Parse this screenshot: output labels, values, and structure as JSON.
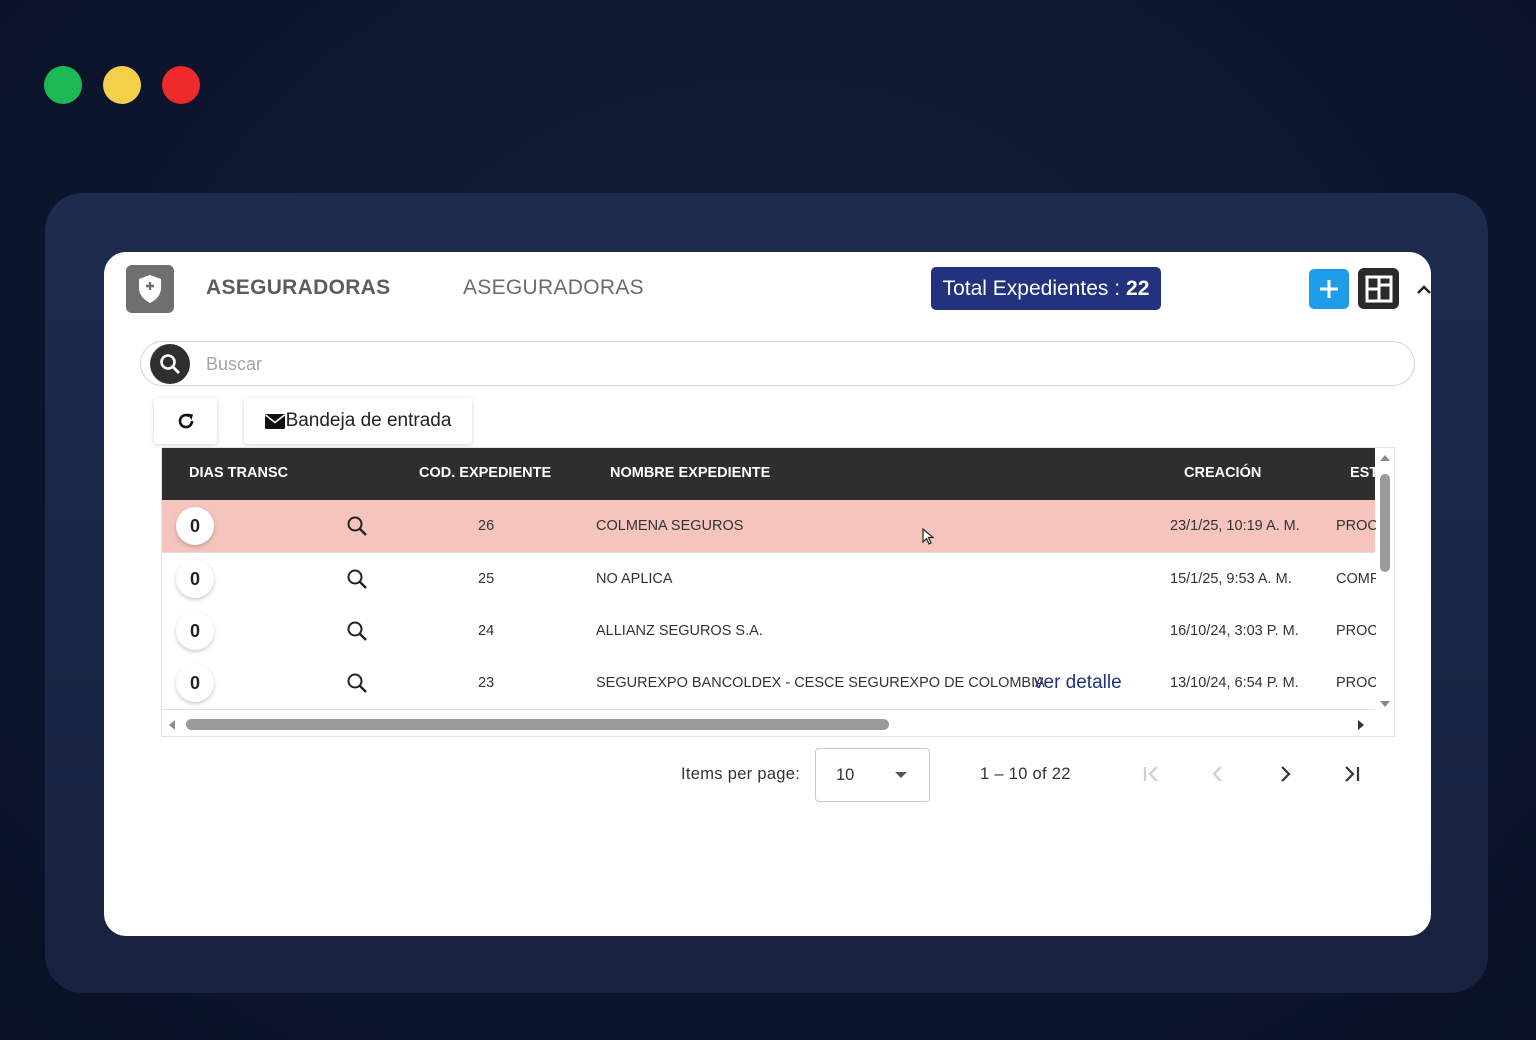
{
  "window_controls": {
    "close_color": "#ee2a2a",
    "minimize_color": "#f4cf4a",
    "maximize_color": "#1db954"
  },
  "header": {
    "logo_icon": "shield-plus-icon",
    "title": "ASEGURADORAS",
    "subtitle": "ASEGURADORAS",
    "total_label": "Total Expedientes :",
    "total_value": "22",
    "add_icon": "plus-icon",
    "layout_icon": "dashboard-layout-icon",
    "collapse_icon": "chevron-up-icon"
  },
  "search": {
    "placeholder": "Buscar",
    "value": ""
  },
  "toolbar": {
    "refresh_icon": "refresh-icon",
    "inbox_icon": "envelope-icon",
    "inbox_label": "Bandeja de entrada"
  },
  "table": {
    "columns": [
      "DIAS TRANSC",
      "COD. EXPEDIENTE",
      "NOMBRE EXPEDIENTE",
      "CREACIÓN",
      "EST"
    ],
    "rows": [
      {
        "dias": "0",
        "codigo": "26",
        "nombre": "COLMENA SEGUROS",
        "creacion": "23/1/25, 10:19 A. M.",
        "estado": "PROC",
        "highlighted": true
      },
      {
        "dias": "0",
        "codigo": "25",
        "nombre": "NO APLICA",
        "creacion": "15/1/25, 9:53 A. M.",
        "estado": "COMF",
        "highlighted": false
      },
      {
        "dias": "0",
        "codigo": "24",
        "nombre": "ALLIANZ SEGUROS S.A.",
        "creacion": "16/10/24, 3:03 P. M.",
        "estado": "PROC",
        "highlighted": false
      },
      {
        "dias": "0",
        "codigo": "23",
        "nombre": "SEGUREXPO BANCOLDEX - CESCE SEGUREXPO DE COLOMBIA",
        "creacion": "13/10/24, 6:54 P. M.",
        "estado": "PROC",
        "highlighted": false,
        "link": "ver detalle"
      }
    ],
    "highlight_color": "#f4c4bd"
  },
  "paginator": {
    "items_per_page_label": "Items per page:",
    "items_per_page_value": "10",
    "range_label": "1 – 10 of 22"
  },
  "colors": {
    "accent_dark_blue": "#22327f",
    "accent_light_blue": "#1e9be9",
    "header_bg": "#2e2e2e"
  }
}
